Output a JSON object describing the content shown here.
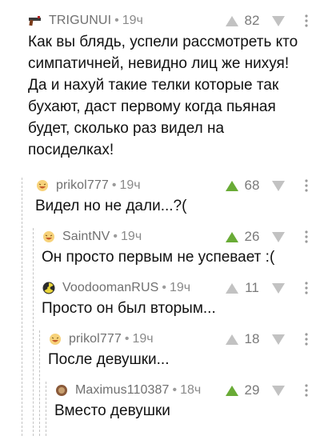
{
  "comments": [
    {
      "author": "TRIGUNUI",
      "time": "19ч",
      "rating": "82",
      "vote": "none",
      "avatar_icon": "gun-avatar-icon",
      "text": "Как вы блядь, успели рассмотреть кто\nсимпатичней, невидно лиц же нихуя!\nДа и нахуй такие телки которые так\nбухают, даст первому когда пьяная\nбудет, сколько раз видел на\nпосиделках!"
    },
    {
      "author": "prikol777",
      "time": "19ч",
      "rating": "68",
      "vote": "up",
      "avatar_icon": "laughing-face-avatar-icon",
      "text": "Видел но не дали...?("
    },
    {
      "author": "SaintNV",
      "time": "19ч",
      "rating": "26",
      "vote": "up",
      "avatar_icon": "laughing-face-avatar-icon",
      "text": "Он просто первым не успевает :("
    },
    {
      "author": "VoodoomanRUS",
      "time": "19ч",
      "rating": "11",
      "vote": "none",
      "avatar_icon": "radiation-avatar-icon",
      "text": "Просто он был вторым..."
    },
    {
      "author": "prikol777",
      "time": "19ч",
      "rating": "18",
      "vote": "none",
      "avatar_icon": "laughing-face-avatar-icon",
      "text": "После девушки..."
    },
    {
      "author": "Maximus110387",
      "time": "18ч",
      "rating": "29",
      "vote": "up",
      "avatar_icon": "brown-circle-avatar-icon",
      "text": "Вместо девушки"
    }
  ],
  "separator": "•",
  "colors": {
    "vote_up_active": "#69ab36",
    "vote_inactive": "#c2c2c2",
    "author": "#707070",
    "text": "#111111",
    "thread_line": "#c4c4c4"
  }
}
